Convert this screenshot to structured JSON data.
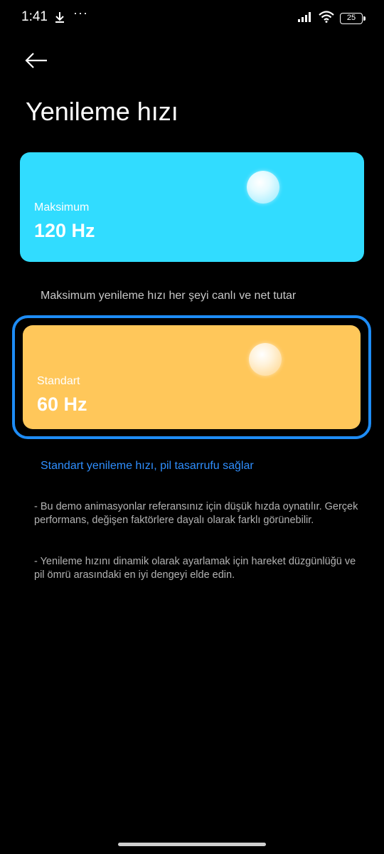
{
  "status_bar": {
    "time": "1:41",
    "icons": [
      "download-icon",
      "more-dots-icon",
      "signal-icon",
      "wifi-icon",
      "battery-icon"
    ],
    "dots": "···",
    "battery_level": "25"
  },
  "header": {
    "back_icon": "arrow-left-icon",
    "title": "Yenileme hızı"
  },
  "options": [
    {
      "label": "Maksimum",
      "value": "120 Hz",
      "description": "Maksimum yenileme hızı her şeyi canlı ve net tutar",
      "color": "#31dcff",
      "selected": false
    },
    {
      "label": "Standart",
      "value": "60 Hz",
      "description": "Standart yenileme hızı, pil tasarrufu sağlar",
      "color": "#ffc75a",
      "selected": true
    }
  ],
  "selection_color": "#1e8cf5",
  "notes": [
    "- Bu demo animasyonlar referansınız için düşük hızda oynatılır. Gerçek performans, değişen faktörlere dayalı olarak farklı görünebilir.",
    "- Yenileme hızını dinamik olarak ayarlamak için hareket düzgünlüğü ve pil ömrü arasındaki en iyi dengeyi elde edin."
  ]
}
